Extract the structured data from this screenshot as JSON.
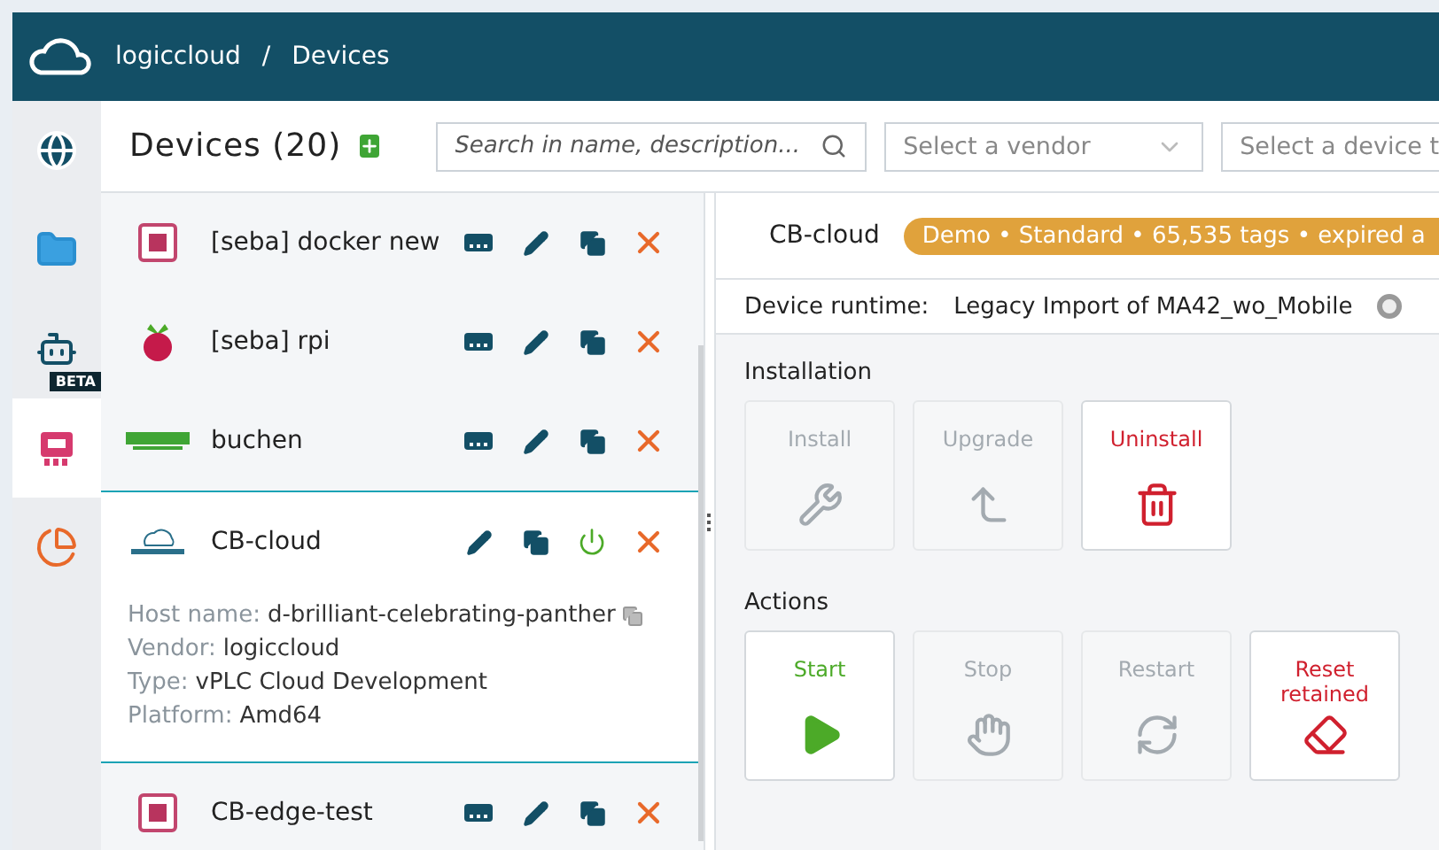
{
  "header": {
    "breadcrumb": [
      "logiccloud",
      "/",
      "Devices"
    ]
  },
  "rail": [
    {
      "kind": "globe",
      "selected": false
    },
    {
      "kind": "folder",
      "selected": false
    },
    {
      "kind": "bot",
      "selected": false,
      "badge": "BETA"
    },
    {
      "kind": "device",
      "selected": true
    },
    {
      "kind": "chart",
      "selected": false
    }
  ],
  "toolbar": {
    "title": "Devices (20)",
    "search_placeholder": "Search in name, description...",
    "vendor_placeholder": "Select a vendor",
    "type_placeholder": "Select a device t"
  },
  "devices": [
    {
      "kind": "chip",
      "name": "[seba] docker new",
      "selected": false,
      "actions": [
        {
          "kind": "deploy"
        },
        {
          "kind": "edit"
        },
        {
          "kind": "copy"
        },
        {
          "kind": "delete"
        }
      ]
    },
    {
      "kind": "raspberry",
      "name": "[seba] rpi",
      "selected": false,
      "actions": [
        {
          "kind": "deploy"
        },
        {
          "kind": "edit"
        },
        {
          "kind": "copy"
        },
        {
          "kind": "delete"
        }
      ]
    },
    {
      "kind": "murr",
      "name": "buchen",
      "selected": false,
      "actions": [
        {
          "kind": "deploy"
        },
        {
          "kind": "edit"
        },
        {
          "kind": "copy"
        },
        {
          "kind": "delete"
        }
      ]
    },
    {
      "kind": "logiccloud",
      "name": "CB-cloud",
      "selected": true,
      "actions": [
        {
          "kind": "edit"
        },
        {
          "kind": "copy"
        },
        {
          "kind": "power"
        },
        {
          "kind": "delete"
        }
      ],
      "details": [
        {
          "kind": "copyable",
          "label": "Host name:",
          "value": "d-brilliant-celebrating-panther"
        },
        {
          "kind": "plain",
          "label": "Vendor:",
          "value": "logiccloud"
        },
        {
          "kind": "plain",
          "label": "Type:",
          "value": "vPLC Cloud Development"
        },
        {
          "kind": "plain",
          "label": "Platform:",
          "value": "Amd64"
        }
      ]
    },
    {
      "kind": "chip",
      "name": "CB-edge-test",
      "selected": false,
      "actions": [
        {
          "kind": "deploy"
        },
        {
          "kind": "edit"
        },
        {
          "kind": "copy"
        },
        {
          "kind": "delete"
        }
      ]
    }
  ],
  "detail": {
    "name": "CB-cloud",
    "license": "Demo • Standard • 65,535 tags • expired a",
    "runtime_label": "Device runtime:",
    "runtime_value": "Legacy Import of MA42_wo_Mobile",
    "runtime_radio": {
      "selected": false
    },
    "sections": [
      {
        "title": "Installation",
        "buttons": [
          {
            "label": "Install",
            "kind": "wrench",
            "disabled": true
          },
          {
            "label": "Upgrade",
            "kind": "upgrade",
            "disabled": true
          },
          {
            "label": "Uninstall",
            "kind": "trash",
            "disabled": false,
            "color": "#d0202e"
          }
        ]
      },
      {
        "title": "Actions",
        "buttons": [
          {
            "label": "Start",
            "kind": "play",
            "disabled": false,
            "color": "#4caa28"
          },
          {
            "label": "Stop",
            "kind": "hand",
            "disabled": true
          },
          {
            "label": "Restart",
            "kind": "restart",
            "disabled": true
          },
          {
            "label": "Reset retained",
            "kind": "eraser",
            "disabled": false,
            "color": "#d0202e"
          }
        ]
      }
    ]
  }
}
